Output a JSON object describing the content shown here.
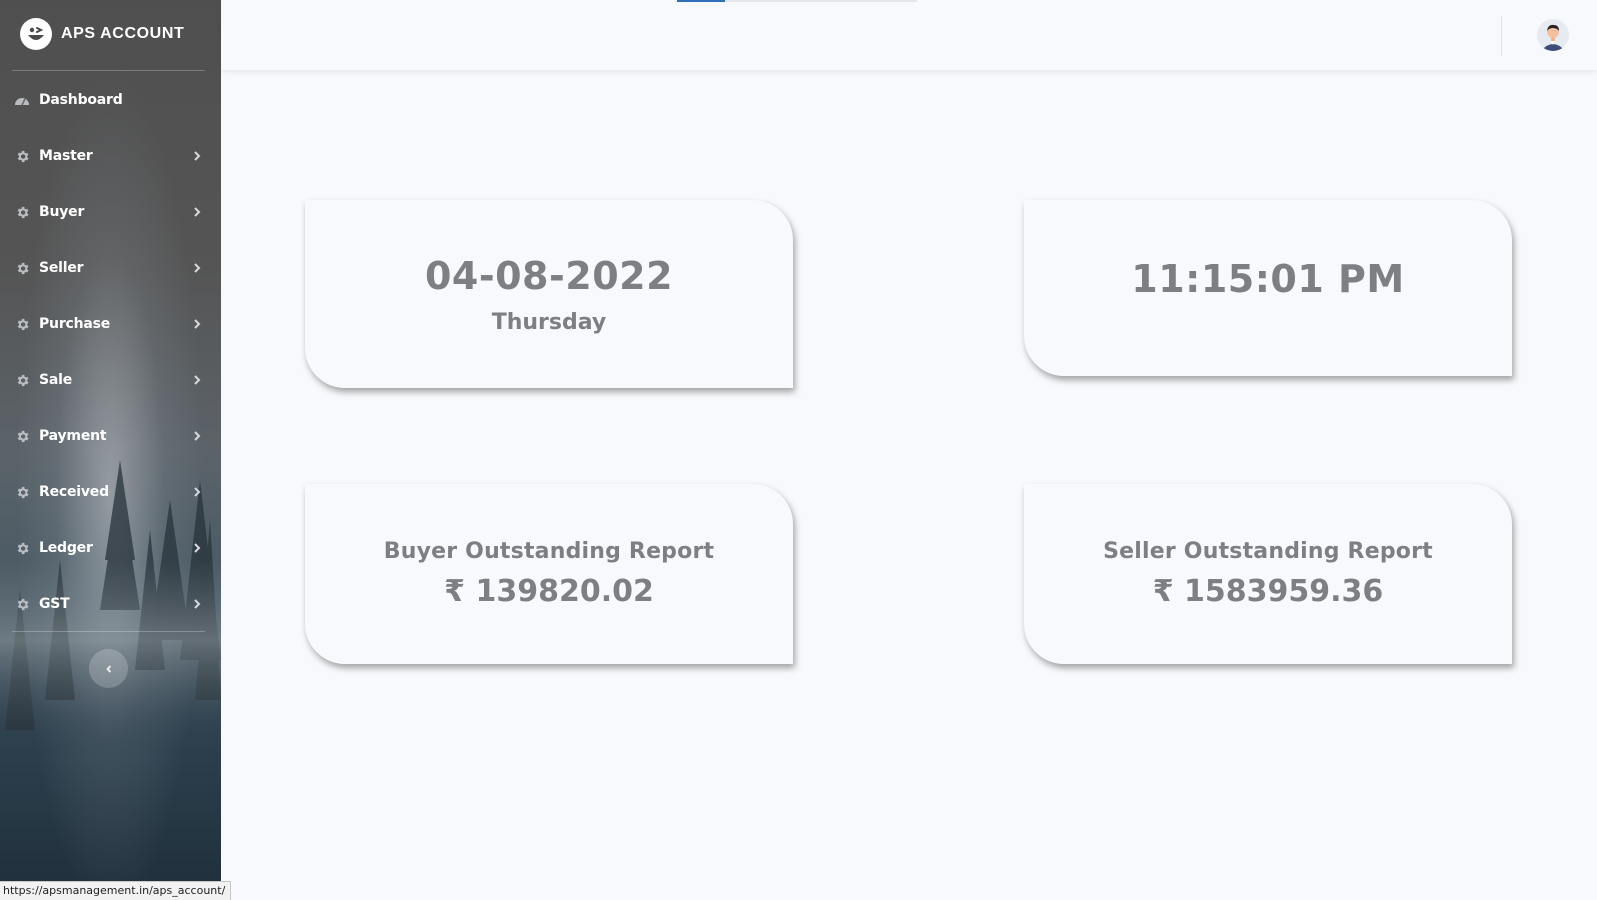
{
  "brand": {
    "name": "APS ACCOUNT",
    "logo_icon": "smiley-logo-icon"
  },
  "sidebar": {
    "items": [
      {
        "label": "Dashboard",
        "icon": "dashboard-icon",
        "has_submenu": false
      },
      {
        "label": "Master",
        "icon": "gear-icon",
        "has_submenu": true
      },
      {
        "label": "Buyer",
        "icon": "gear-icon",
        "has_submenu": true
      },
      {
        "label": "Seller",
        "icon": "gear-icon",
        "has_submenu": true
      },
      {
        "label": "Purchase",
        "icon": "gear-icon",
        "has_submenu": true
      },
      {
        "label": "Sale",
        "icon": "gear-icon",
        "has_submenu": true
      },
      {
        "label": "Payment",
        "icon": "gear-icon",
        "has_submenu": true
      },
      {
        "label": "Received",
        "icon": "gear-icon",
        "has_submenu": true
      },
      {
        "label": "Ledger",
        "icon": "gear-icon",
        "has_submenu": true
      },
      {
        "label": "GST",
        "icon": "gear-icon",
        "has_submenu": true
      }
    ],
    "collapse_icon": "chevron-left-icon"
  },
  "header": {
    "avatar_icon": "user-avatar-icon"
  },
  "cards": {
    "date": {
      "value": "04-08-2022",
      "day": "Thursday"
    },
    "time": {
      "value": "11:15:01 PM"
    },
    "buyer": {
      "title": "Buyer Outstanding Report",
      "value": "₹ 139820.02"
    },
    "seller": {
      "title": "Seller Outstanding Report",
      "value": "₹ 1583959.36"
    }
  },
  "status_bar": {
    "url": "https://apsmanagement.in/aps_account/"
  },
  "colors": {
    "card_text": "#7d7f85",
    "page_bg": "#f7f9fc",
    "progress_accent": "#2f6fb7"
  }
}
